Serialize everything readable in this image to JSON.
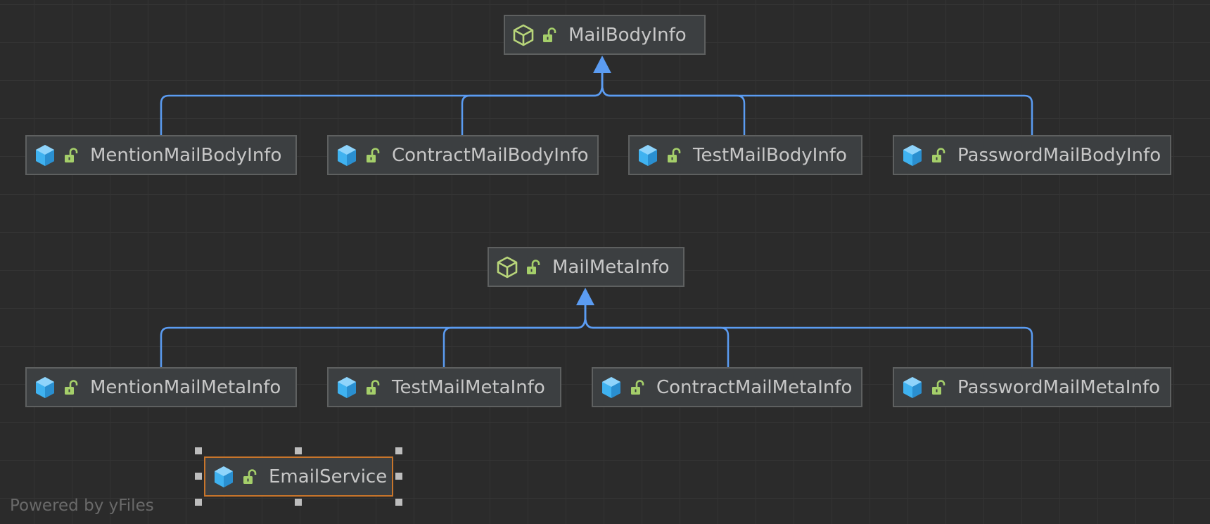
{
  "diagram": {
    "interfaces": {
      "mail_body_info": "MailBodyInfo",
      "mail_meta_info": "MailMetaInfo"
    },
    "body_implementations": [
      "MentionMailBodyInfo",
      "ContractMailBodyInfo",
      "TestMailBodyInfo",
      "PasswordMailBodyInfo"
    ],
    "meta_implementations": [
      "MentionMailMetaInfo",
      "TestMailMetaInfo",
      "ContractMailMetaInfo",
      "PasswordMailMetaInfo"
    ],
    "standalone": "EmailService",
    "watermark": "Powered by yFiles"
  },
  "icons": {
    "interface": "interface-icon",
    "class": "class-icon",
    "visibility": "public-unlock-icon"
  },
  "colors": {
    "background": "#2b2b2b",
    "node_fill": "#3c3f41",
    "node_border": "#5e6060",
    "selected_border": "#c8752b",
    "edge": "#5b9cf2",
    "interface_icon": "#b8d57a",
    "class_icon": "#3fb2f0",
    "lock_icon": "#a5cf6a"
  }
}
